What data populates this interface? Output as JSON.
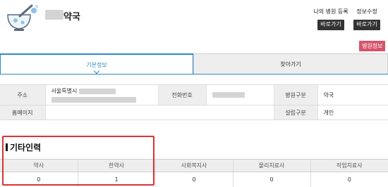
{
  "header": {
    "pharmacy_name": "약국",
    "register_label": "나의 병원 등록",
    "register_button": "바로가기",
    "edit_label": "정보수정",
    "edit_button": "바로가기"
  },
  "badge": "병원정보",
  "tabs": [
    {
      "label": "기본정보",
      "active": true
    },
    {
      "label": "찾아가기",
      "active": false
    }
  ],
  "info": {
    "address_label": "주소",
    "address_value": "서울특별시",
    "phone_label": "전화번호",
    "type_label": "병원구분",
    "type_value": "약국",
    "homepage_label": "홈페이지",
    "homepage_value": "",
    "est_label": "설립구분",
    "est_value": "개인"
  },
  "staff": {
    "title": "기타인력",
    "columns": [
      "약사",
      "한약사",
      "사회복지사",
      "물리치료사",
      "작업치료사"
    ],
    "values": [
      "0",
      "1",
      "0",
      "0",
      "0"
    ]
  },
  "colors": {
    "accent": "#2a8bc6",
    "badge": "#d6546b",
    "highlight": "#d93434"
  }
}
